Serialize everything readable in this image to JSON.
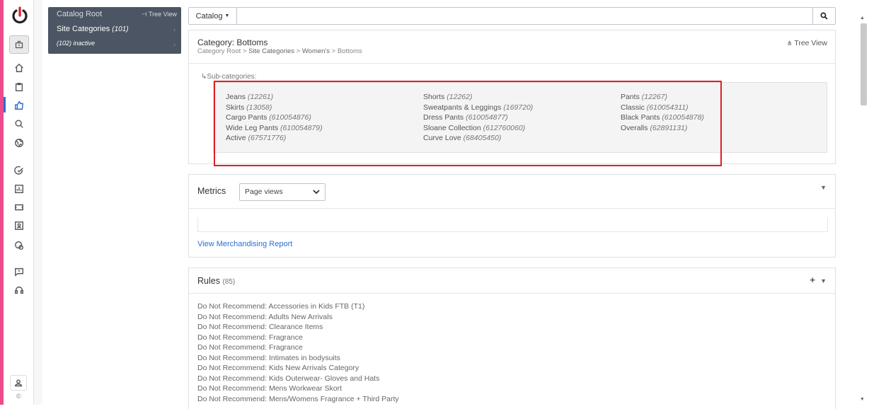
{
  "sidebar": {
    "icons": [
      "power-icon",
      "dashboard-icon",
      "home-icon",
      "clipboard-icon",
      "thumbs-up-icon",
      "search-icon",
      "globe-icon",
      "check-circle-icon",
      "chart-icon",
      "ticket-icon",
      "contact-icon",
      "badge-icon",
      "chat-icon",
      "headset-icon",
      "user-icon",
      "copyright-icon"
    ],
    "footer_symbol": "©"
  },
  "tree_panel": {
    "root_label": "Catalog Root",
    "tree_view_label": "Tree View",
    "site_categories_label": "Site Categories",
    "site_categories_count": "(101)",
    "inactive_label": "(102) inactive"
  },
  "search_bar": {
    "dropdown_label": "Catalog"
  },
  "category": {
    "title": "Category: Bottoms",
    "breadcrumb": [
      "Category Root",
      "Site Categories",
      "Women's",
      "Bottoms"
    ],
    "tree_view_label": "Tree View",
    "subcategories_heading": "Sub-categories:",
    "columns": [
      [
        {
          "name": "Jeans",
          "id": "(12261)"
        },
        {
          "name": "Skirts",
          "id": "(13058)"
        },
        {
          "name": "Cargo Pants",
          "id": "(610054876)"
        },
        {
          "name": "Wide Leg Pants",
          "id": "(610054879)"
        },
        {
          "name": "Active",
          "id": "(67571776)"
        }
      ],
      [
        {
          "name": "Shorts",
          "id": "(12262)"
        },
        {
          "name": "Sweatpants & Leggings",
          "id": "(169720)"
        },
        {
          "name": "Dress Pants",
          "id": "(610054877)"
        },
        {
          "name": "Sloane Collection",
          "id": "(612760060)"
        },
        {
          "name": "Curve Love",
          "id": "(68405450)"
        }
      ],
      [
        {
          "name": "Pants",
          "id": "(12267)"
        },
        {
          "name": "Classic",
          "id": "(610054311)"
        },
        {
          "name": "Black Pants",
          "id": "(610054878)"
        },
        {
          "name": "Overalls",
          "id": "(62891131)"
        }
      ]
    ]
  },
  "metrics": {
    "title": "Metrics",
    "select_value": "Page views",
    "report_link": "View Merchandising Report"
  },
  "rules": {
    "title": "Rules",
    "count": "(85)",
    "items": [
      "Do Not Recommend: Accessories in Kids FTB (T1)",
      "Do Not Recommend: Adults New Arrivals",
      "Do Not Recommend: Clearance Items",
      "Do Not Recommend: Fragrance",
      "Do Not Recommend: Fragrance",
      "Do Not Recommend: Intimates in bodysuits",
      "Do Not Recommend: Kids New Arrivals Category",
      "Do Not Recommend: Kids Outerwear- Gloves and Hats",
      "Do Not Recommend: Mens Workwear Skort",
      "Do Not Recommend: Mens/Womens Fragrance + Third Party"
    ]
  },
  "colors": {
    "accent": "#2c6fd0",
    "brand_pink": "#ec4c8c",
    "power_red": "#e01f28",
    "panel_dark": "#4b5563"
  }
}
